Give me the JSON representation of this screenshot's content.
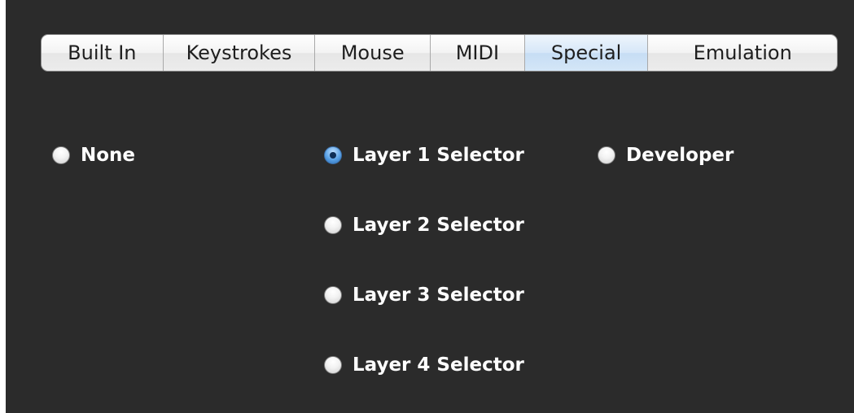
{
  "tabs": [
    {
      "label": "Built In",
      "selected": false
    },
    {
      "label": "Keystrokes",
      "selected": false
    },
    {
      "label": "Mouse",
      "selected": false
    },
    {
      "label": "MIDI",
      "selected": false
    },
    {
      "label": "Special",
      "selected": true
    },
    {
      "label": "Emulation",
      "selected": false
    }
  ],
  "options": {
    "none": {
      "label": "None",
      "checked": false
    },
    "layer1": {
      "label": "Layer 1 Selector",
      "checked": true
    },
    "developer": {
      "label": "Developer",
      "checked": false
    },
    "layer2": {
      "label": "Layer 2 Selector",
      "checked": false
    },
    "layer3": {
      "label": "Layer 3 Selector",
      "checked": false
    },
    "layer4": {
      "label": "Layer 4 Selector",
      "checked": false
    }
  }
}
